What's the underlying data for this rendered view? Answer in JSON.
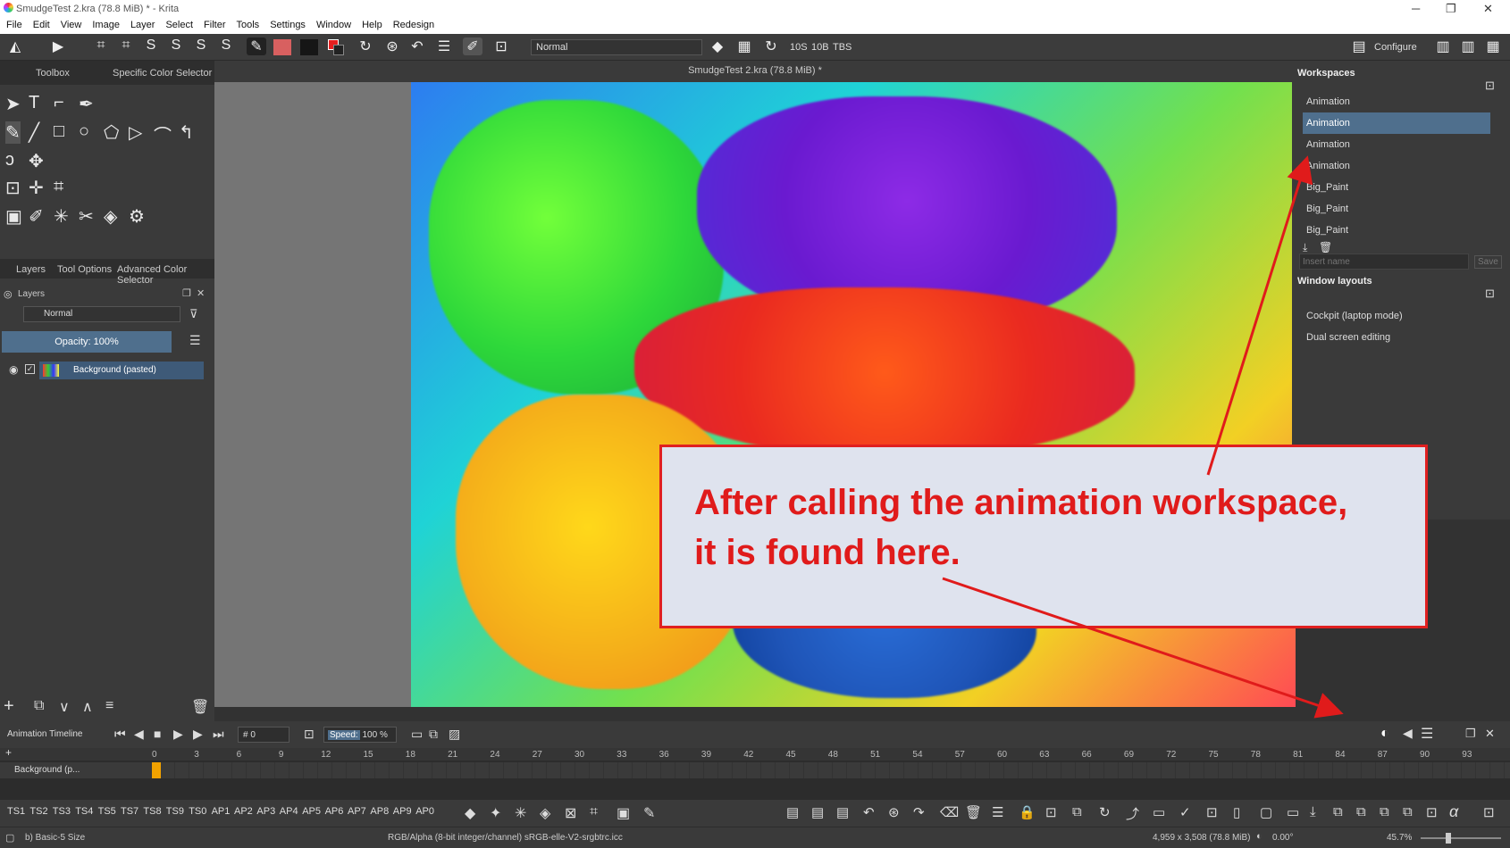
{
  "window": {
    "title": "SmudgeTest 2.kra (78.8 MiB) * - Krita"
  },
  "menu": [
    "File",
    "Edit",
    "View",
    "Image",
    "Layer",
    "Select",
    "Filter",
    "Tools",
    "Settings",
    "Window",
    "Help",
    "Redesign"
  ],
  "toolbar": {
    "blend_mode": "Normal",
    "presets": [
      "10S",
      "10B",
      "TBS"
    ],
    "configure": "Configure"
  },
  "left_dock": {
    "tabs": [
      "Toolbox",
      "Specific Color Selector"
    ],
    "bottom_tabs": [
      "Layers",
      "Tool Options",
      "Advanced Color Selector"
    ],
    "layers_title": "Layers",
    "blend": "Normal",
    "opacity": "Opacity:  100%",
    "layer_name": "Background (pasted)"
  },
  "canvas": {
    "doc_title": "SmudgeTest 2.kra (78.8 MiB) *"
  },
  "workspaces": {
    "title": "Workspaces",
    "items": [
      "Animation",
      "Animation",
      "Animation",
      "Animation",
      "Big_Paint",
      "Big_Paint",
      "Big_Paint"
    ],
    "selected_index": 1,
    "name_placeholder": "Insert name",
    "save": "Save",
    "layouts_title": "Window layouts",
    "layouts": [
      "Cockpit (laptop mode)",
      "Dual screen editing"
    ]
  },
  "callout": {
    "line1": "After calling the animation workspace,",
    "line2": "it is found here."
  },
  "animation": {
    "title": "Animation Timeline",
    "frame": "# 0",
    "speed_label": "Speed:",
    "speed_value": "100 %",
    "ticks": [
      "0",
      "3",
      "6",
      "9",
      "12",
      "15",
      "18",
      "21",
      "24",
      "27",
      "30",
      "33",
      "36",
      "39",
      "42",
      "45",
      "48",
      "51",
      "54",
      "57",
      "60",
      "63",
      "66",
      "69",
      "72",
      "75",
      "78",
      "81",
      "84",
      "87",
      "90",
      "93"
    ],
    "layer_name": "Background (p..."
  },
  "brush_presets": [
    "TS1",
    "TS2",
    "TS3",
    "TS4",
    "TS5",
    "TS7",
    "TS8",
    "TS9",
    "TS0",
    "AP1",
    "AP2",
    "AP3",
    "AP4",
    "AP5",
    "AP6",
    "AP7",
    "AP8",
    "AP9",
    "AP0"
  ],
  "status": {
    "brush": "b) Basic-5 Size",
    "color": "RGB/Alpha (8-bit integer/channel)  sRGB-elle-V2-srgbtrc.icc",
    "size": "4,959 x 3,508 (78.8 MiB)",
    "rotation": "0.00°",
    "zoom": "45.7%"
  },
  "colors": {
    "accent": "#4f6f8d",
    "callout_red": "#e01b1b"
  }
}
